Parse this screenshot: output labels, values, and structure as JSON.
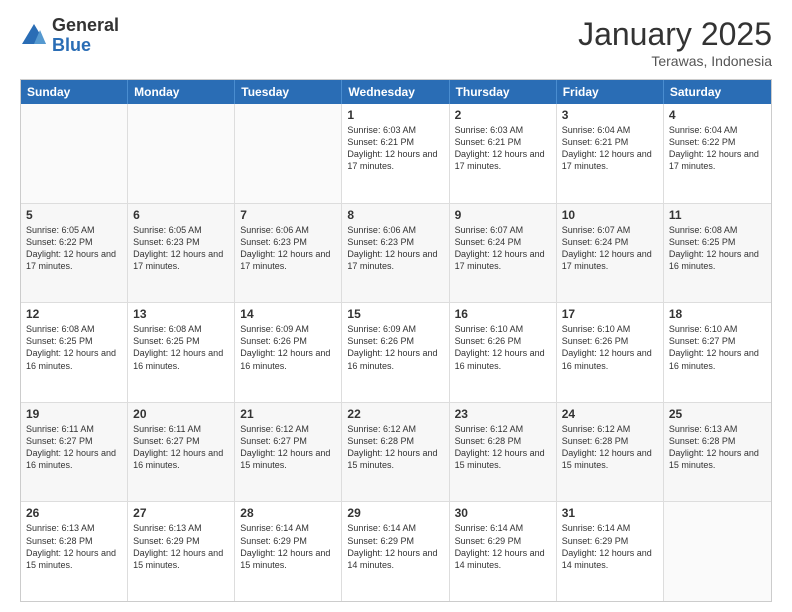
{
  "logo": {
    "general": "General",
    "blue": "Blue"
  },
  "header": {
    "month": "January 2025",
    "location": "Terawas, Indonesia"
  },
  "weekdays": [
    "Sunday",
    "Monday",
    "Tuesday",
    "Wednesday",
    "Thursday",
    "Friday",
    "Saturday"
  ],
  "rows": [
    [
      {
        "day": "",
        "text": ""
      },
      {
        "day": "",
        "text": ""
      },
      {
        "day": "",
        "text": ""
      },
      {
        "day": "1",
        "text": "Sunrise: 6:03 AM\nSunset: 6:21 PM\nDaylight: 12 hours and 17 minutes."
      },
      {
        "day": "2",
        "text": "Sunrise: 6:03 AM\nSunset: 6:21 PM\nDaylight: 12 hours and 17 minutes."
      },
      {
        "day": "3",
        "text": "Sunrise: 6:04 AM\nSunset: 6:21 PM\nDaylight: 12 hours and 17 minutes."
      },
      {
        "day": "4",
        "text": "Sunrise: 6:04 AM\nSunset: 6:22 PM\nDaylight: 12 hours and 17 minutes."
      }
    ],
    [
      {
        "day": "5",
        "text": "Sunrise: 6:05 AM\nSunset: 6:22 PM\nDaylight: 12 hours and 17 minutes."
      },
      {
        "day": "6",
        "text": "Sunrise: 6:05 AM\nSunset: 6:23 PM\nDaylight: 12 hours and 17 minutes."
      },
      {
        "day": "7",
        "text": "Sunrise: 6:06 AM\nSunset: 6:23 PM\nDaylight: 12 hours and 17 minutes."
      },
      {
        "day": "8",
        "text": "Sunrise: 6:06 AM\nSunset: 6:23 PM\nDaylight: 12 hours and 17 minutes."
      },
      {
        "day": "9",
        "text": "Sunrise: 6:07 AM\nSunset: 6:24 PM\nDaylight: 12 hours and 17 minutes."
      },
      {
        "day": "10",
        "text": "Sunrise: 6:07 AM\nSunset: 6:24 PM\nDaylight: 12 hours and 17 minutes."
      },
      {
        "day": "11",
        "text": "Sunrise: 6:08 AM\nSunset: 6:25 PM\nDaylight: 12 hours and 16 minutes."
      }
    ],
    [
      {
        "day": "12",
        "text": "Sunrise: 6:08 AM\nSunset: 6:25 PM\nDaylight: 12 hours and 16 minutes."
      },
      {
        "day": "13",
        "text": "Sunrise: 6:08 AM\nSunset: 6:25 PM\nDaylight: 12 hours and 16 minutes."
      },
      {
        "day": "14",
        "text": "Sunrise: 6:09 AM\nSunset: 6:26 PM\nDaylight: 12 hours and 16 minutes."
      },
      {
        "day": "15",
        "text": "Sunrise: 6:09 AM\nSunset: 6:26 PM\nDaylight: 12 hours and 16 minutes."
      },
      {
        "day": "16",
        "text": "Sunrise: 6:10 AM\nSunset: 6:26 PM\nDaylight: 12 hours and 16 minutes."
      },
      {
        "day": "17",
        "text": "Sunrise: 6:10 AM\nSunset: 6:26 PM\nDaylight: 12 hours and 16 minutes."
      },
      {
        "day": "18",
        "text": "Sunrise: 6:10 AM\nSunset: 6:27 PM\nDaylight: 12 hours and 16 minutes."
      }
    ],
    [
      {
        "day": "19",
        "text": "Sunrise: 6:11 AM\nSunset: 6:27 PM\nDaylight: 12 hours and 16 minutes."
      },
      {
        "day": "20",
        "text": "Sunrise: 6:11 AM\nSunset: 6:27 PM\nDaylight: 12 hours and 16 minutes."
      },
      {
        "day": "21",
        "text": "Sunrise: 6:12 AM\nSunset: 6:27 PM\nDaylight: 12 hours and 15 minutes."
      },
      {
        "day": "22",
        "text": "Sunrise: 6:12 AM\nSunset: 6:28 PM\nDaylight: 12 hours and 15 minutes."
      },
      {
        "day": "23",
        "text": "Sunrise: 6:12 AM\nSunset: 6:28 PM\nDaylight: 12 hours and 15 minutes."
      },
      {
        "day": "24",
        "text": "Sunrise: 6:12 AM\nSunset: 6:28 PM\nDaylight: 12 hours and 15 minutes."
      },
      {
        "day": "25",
        "text": "Sunrise: 6:13 AM\nSunset: 6:28 PM\nDaylight: 12 hours and 15 minutes."
      }
    ],
    [
      {
        "day": "26",
        "text": "Sunrise: 6:13 AM\nSunset: 6:28 PM\nDaylight: 12 hours and 15 minutes."
      },
      {
        "day": "27",
        "text": "Sunrise: 6:13 AM\nSunset: 6:29 PM\nDaylight: 12 hours and 15 minutes."
      },
      {
        "day": "28",
        "text": "Sunrise: 6:14 AM\nSunset: 6:29 PM\nDaylight: 12 hours and 15 minutes."
      },
      {
        "day": "29",
        "text": "Sunrise: 6:14 AM\nSunset: 6:29 PM\nDaylight: 12 hours and 14 minutes."
      },
      {
        "day": "30",
        "text": "Sunrise: 6:14 AM\nSunset: 6:29 PM\nDaylight: 12 hours and 14 minutes."
      },
      {
        "day": "31",
        "text": "Sunrise: 6:14 AM\nSunset: 6:29 PM\nDaylight: 12 hours and 14 minutes."
      },
      {
        "day": "",
        "text": ""
      }
    ]
  ]
}
